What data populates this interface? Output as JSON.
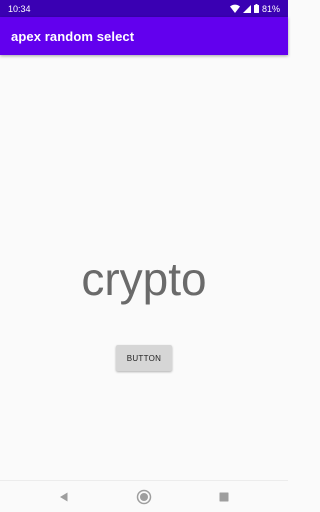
{
  "status_bar": {
    "time": "10:34",
    "battery": "81%",
    "icons": [
      "wifi-icon",
      "cellular-signal-icon",
      "battery-icon"
    ]
  },
  "app_bar": {
    "title": "apex random select",
    "color": "#6200ee"
  },
  "main": {
    "display_text": "crypto",
    "button_label": "BUTTON"
  },
  "nav_bar": {
    "icons": [
      "back-icon",
      "home-icon",
      "recents-icon"
    ]
  }
}
